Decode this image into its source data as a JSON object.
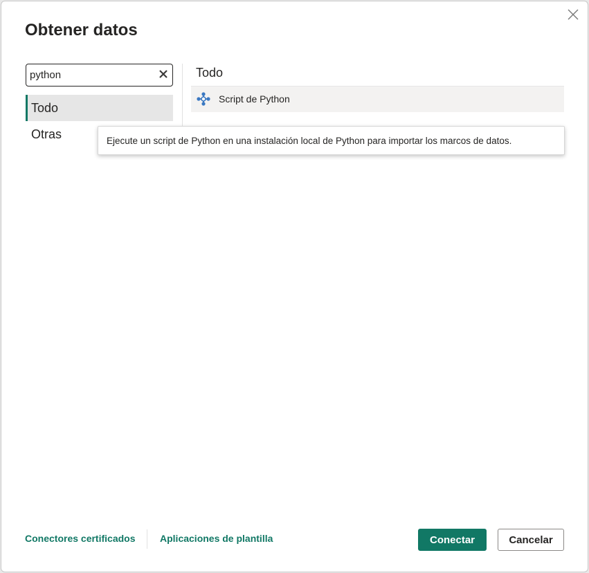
{
  "dialog": {
    "title": "Obtener datos"
  },
  "search": {
    "value": "python",
    "clear_icon": "close-icon"
  },
  "categories": [
    {
      "label": "Todo",
      "selected": true
    },
    {
      "label": "Otras",
      "selected": false
    }
  ],
  "results": {
    "header": "Todo",
    "items": [
      {
        "label": "Script de Python",
        "icon": "python-connector-icon"
      }
    ]
  },
  "tooltip": {
    "text": "Ejecute un script de Python en una instalación local de Python para importar los marcos de datos."
  },
  "footer": {
    "certified_link": "Conectores certificados",
    "template_link": "Aplicaciones de plantilla",
    "connect_label": "Conectar",
    "cancel_label": "Cancelar"
  },
  "colors": {
    "accent": "#117865",
    "text": "#252423",
    "selected_bg": "#e6e6e6",
    "result_bg": "#f3f2f1"
  }
}
